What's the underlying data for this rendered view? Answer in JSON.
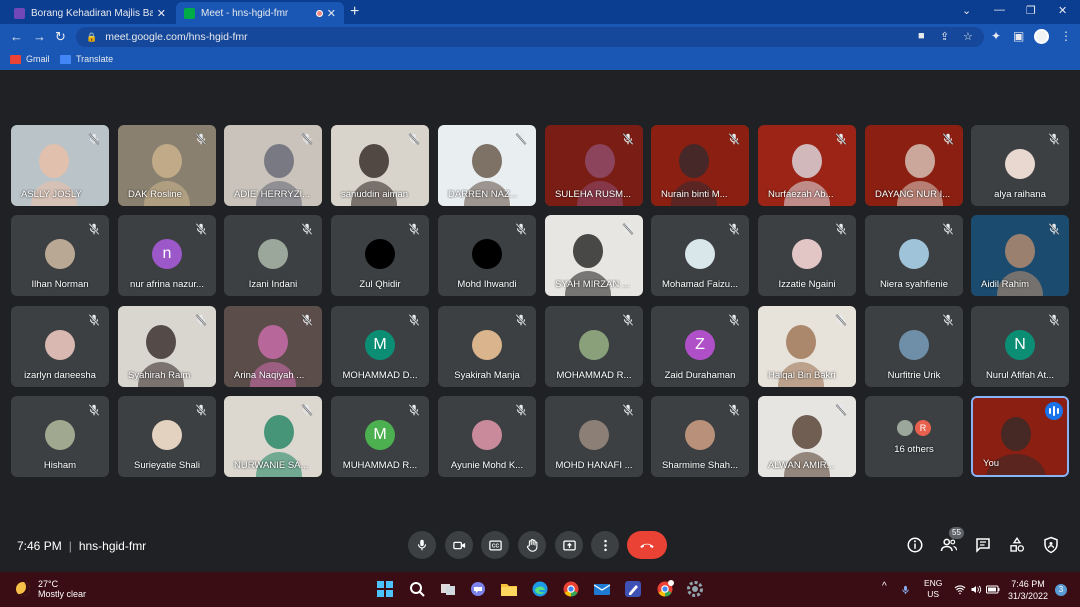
{
  "browser": {
    "tabs": [
      {
        "title": "Borang Kehadiran Majlis Bacaan",
        "close": "✕",
        "favicon_color": "#7248b9"
      },
      {
        "title": "Meet - hns-hgid-fmr",
        "close": "✕",
        "favicon_color": "#00ac47"
      }
    ],
    "new_tab": "+",
    "url": "meet.google.com/hns-hgid-fmr",
    "bookmarks": [
      {
        "label": "Gmail",
        "icon_color": "#ea4335"
      },
      {
        "label": "Translate",
        "icon_color": "#4285f4"
      }
    ],
    "window_controls": {
      "chevron": "⌄",
      "minimize": "—",
      "restore": "❐",
      "close": "✕"
    }
  },
  "meeting": {
    "time": "7:46 PM",
    "separator": "|",
    "code": "hns-hgid-fmr",
    "participant_count": "55",
    "accent_color": "#8ab4f8",
    "end_call_color": "#ea4335"
  },
  "participants": [
    {
      "name": "ASLLY JOSLY",
      "type": "video",
      "bg": "#b9c3c8",
      "fg": "#e8c0a8"
    },
    {
      "name": "DAK Rosline",
      "type": "video",
      "bg": "#8a8070",
      "fg": "#c9b28c"
    },
    {
      "name": "ADIE' HERRYZI...",
      "type": "video",
      "bg": "#c9c3bb",
      "fg": "#6a6c78"
    },
    {
      "name": "sanuddin aiman",
      "type": "video",
      "bg": "#d8d4cc",
      "fg": "#3b2f2a"
    },
    {
      "name": "DARREN NAZ...",
      "type": "video",
      "bg": "#e9eef1",
      "fg": "#6b5a4e"
    },
    {
      "name": "SULEHA RUSM...",
      "type": "video",
      "bg": "#7a1d14",
      "fg": "#8f4b6a"
    },
    {
      "name": "Nurain binti M...",
      "type": "video",
      "bg": "#8a1f12",
      "fg": "#3a2a2e"
    },
    {
      "name": "Nurfaezah Ab...",
      "type": "video",
      "bg": "#9b2416",
      "fg": "#d9d2d8"
    },
    {
      "name": "DAYANG NUR I...",
      "type": "video",
      "bg": "#8a1f12",
      "fg": "#d6c0b4"
    },
    {
      "name": "alya raihana",
      "type": "avatar",
      "av": "#e8d8d0",
      "letter": ""
    },
    {
      "name": "Ilhan Norman",
      "type": "avatar",
      "av": "#b9a894",
      "letter": ""
    },
    {
      "name": "nur afrina nazur...",
      "type": "avatar",
      "av": "#9c58c8",
      "letter": "n"
    },
    {
      "name": "Izani Indani",
      "type": "avatar",
      "av": "#9aa79a",
      "letter": ""
    },
    {
      "name": "Zul Qhidir",
      "type": "avatar",
      "av": "#000000",
      "letter": ""
    },
    {
      "name": "Mohd Ihwandi",
      "type": "avatar",
      "av": "#000000",
      "letter": ""
    },
    {
      "name": "SYAH MIRZAN ...",
      "type": "video",
      "bg": "#e8e6e2",
      "fg": "#2b2b2b"
    },
    {
      "name": "Mohamad Faizu...",
      "type": "avatar",
      "av": "#d9e6ea",
      "letter": ""
    },
    {
      "name": "Izzatie Ngaini",
      "type": "avatar",
      "av": "#e2c6c6",
      "letter": ""
    },
    {
      "name": "Niera syahfienie",
      "type": "avatar",
      "av": "#9fc3d9",
      "letter": ""
    },
    {
      "name": "Aidil Rahim",
      "type": "video",
      "bg": "#1b4b6e",
      "fg": "#b08a6e"
    },
    {
      "name": "izarlyn daneesha",
      "type": "avatar",
      "av": "#d8b8b0",
      "letter": ""
    },
    {
      "name": "Syahirah Raim",
      "type": "video",
      "bg": "#d9d5cf",
      "fg": "#3c3230"
    },
    {
      "name": "Arina Naqiyah ...",
      "type": "video",
      "bg": "#5b4d49",
      "fg": "#c86ca8"
    },
    {
      "name": "MOHAMMAD D...",
      "type": "avatar",
      "av": "#0b8e73",
      "letter": "M"
    },
    {
      "name": "Syakirah Manja",
      "type": "avatar",
      "av": "#d9b48c",
      "letter": ""
    },
    {
      "name": "MOHAMMAD R...",
      "type": "avatar",
      "av": "#8aa07a",
      "letter": ""
    },
    {
      "name": "Zaid Durahaman",
      "type": "avatar",
      "av": "#b050c8",
      "letter": "Z"
    },
    {
      "name": "Haiqal Bin Bakri",
      "type": "video",
      "bg": "#e7e2da",
      "fg": "#a07858"
    },
    {
      "name": "Nurfitrie Urik",
      "type": "avatar",
      "av": "#6f8ea8",
      "letter": ""
    },
    {
      "name": "Nurul Afifah At...",
      "type": "avatar",
      "av": "#0b8e73",
      "letter": "N"
    },
    {
      "name": "Hisham",
      "type": "avatar",
      "av": "#a1a890",
      "letter": ""
    },
    {
      "name": "Surieyatie Shali",
      "type": "avatar",
      "av": "#e4d2c0",
      "letter": ""
    },
    {
      "name": "NURWANIE SA...",
      "type": "video",
      "bg": "#dcd8d0",
      "fg": "#2b8a6a"
    },
    {
      "name": "MUHAMMAD R...",
      "type": "avatar",
      "av": "#4caf50",
      "letter": "M"
    },
    {
      "name": "Ayunie Mohd K...",
      "type": "avatar",
      "av": "#c98a9c",
      "letter": ""
    },
    {
      "name": "MOHD HANAFI ...",
      "type": "avatar",
      "av": "#8c7f76",
      "letter": ""
    },
    {
      "name": "Sharmime Shah...",
      "type": "avatar",
      "av": "#b9907a",
      "letter": ""
    },
    {
      "name": "ALWAN AMIR...",
      "type": "video",
      "bg": "#e7e5e1",
      "fg": "#5b4638"
    },
    {
      "name": "16 others",
      "type": "others",
      "letter": "R"
    },
    {
      "name": "You",
      "type": "you",
      "bg": "#8a1f12",
      "fg": "#3a2a28"
    }
  ],
  "taskbar": {
    "temp": "27°C",
    "weather": "Mostly clear",
    "lang": "ENG",
    "region": "US",
    "time": "7:46 PM",
    "date": "31/3/2022",
    "notifications": "3",
    "tray_chevron": "^"
  }
}
